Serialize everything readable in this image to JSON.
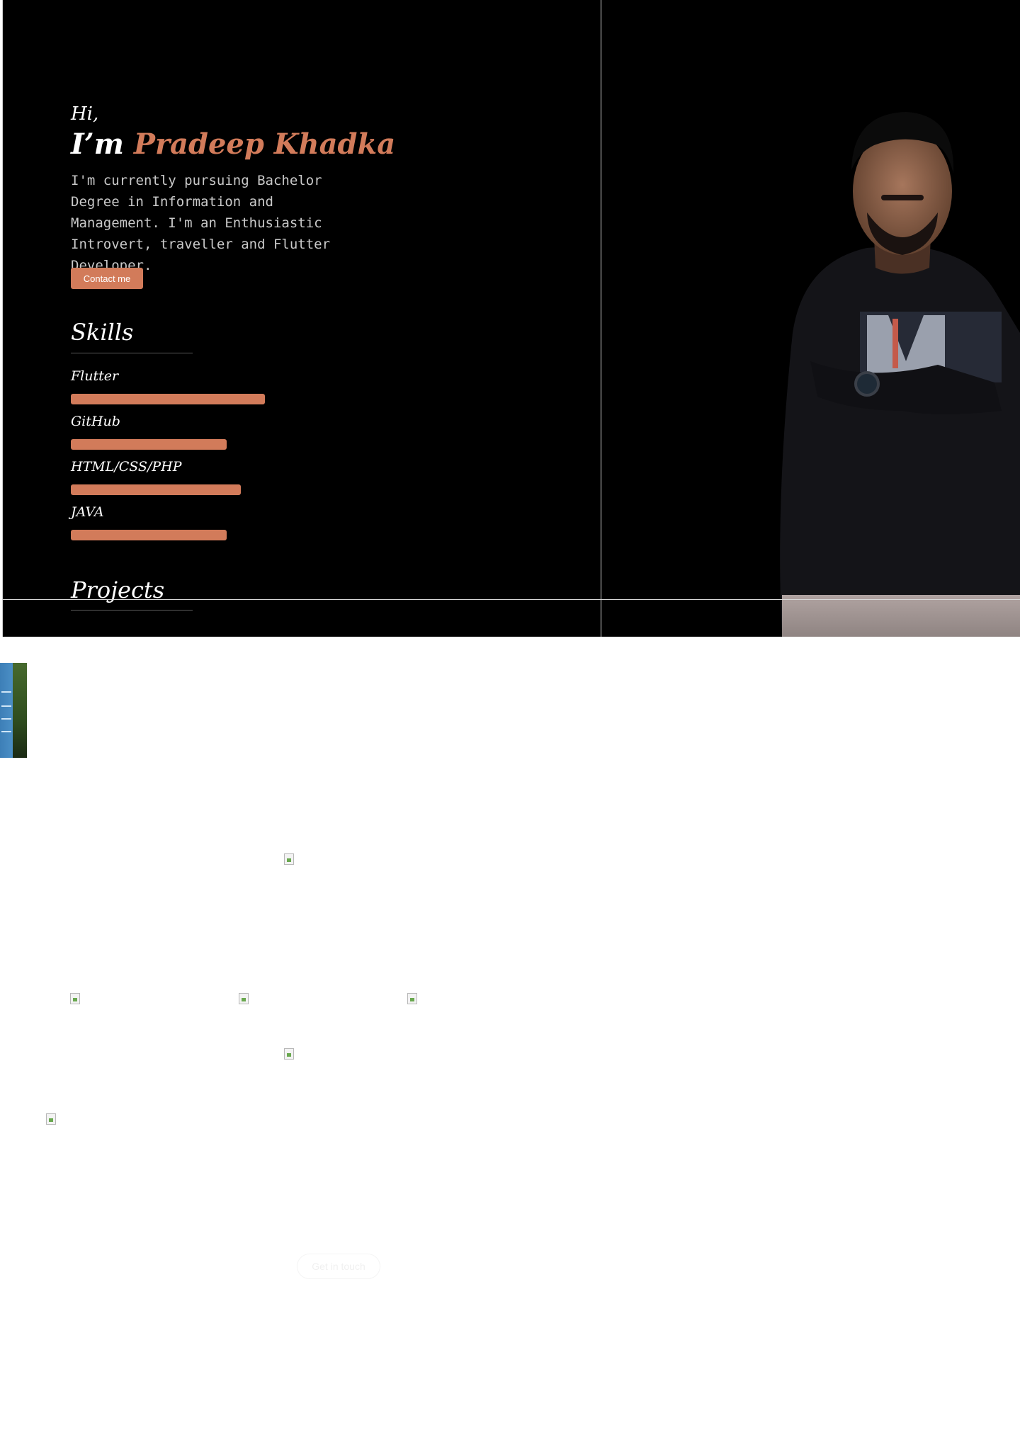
{
  "hero": {
    "greeting": "Hi,",
    "name_prefix": "I’m",
    "name": "Pradeep Khadka",
    "intro": "I'm currently pursuing Bachelor Degree in Information and Management. I'm an Enthusiastic Introvert, traveller and Flutter Developer.",
    "contact_label": "Contact me"
  },
  "skills": {
    "title": "Skills",
    "items": [
      {
        "name": "Flutter",
        "level": 0.82
      },
      {
        "name": "GitHub",
        "level": 0.66
      },
      {
        "name": "HTML/CSS/PHP",
        "level": 0.72
      },
      {
        "name": "JAVA",
        "level": 0.66
      }
    ]
  },
  "projects": {
    "title": "Projects"
  },
  "footer_button_label": "Get in touch",
  "colors": {
    "accent": "#d27b5a",
    "background": "#000000"
  },
  "icons": {
    "broken_image": "broken-image-icon"
  }
}
